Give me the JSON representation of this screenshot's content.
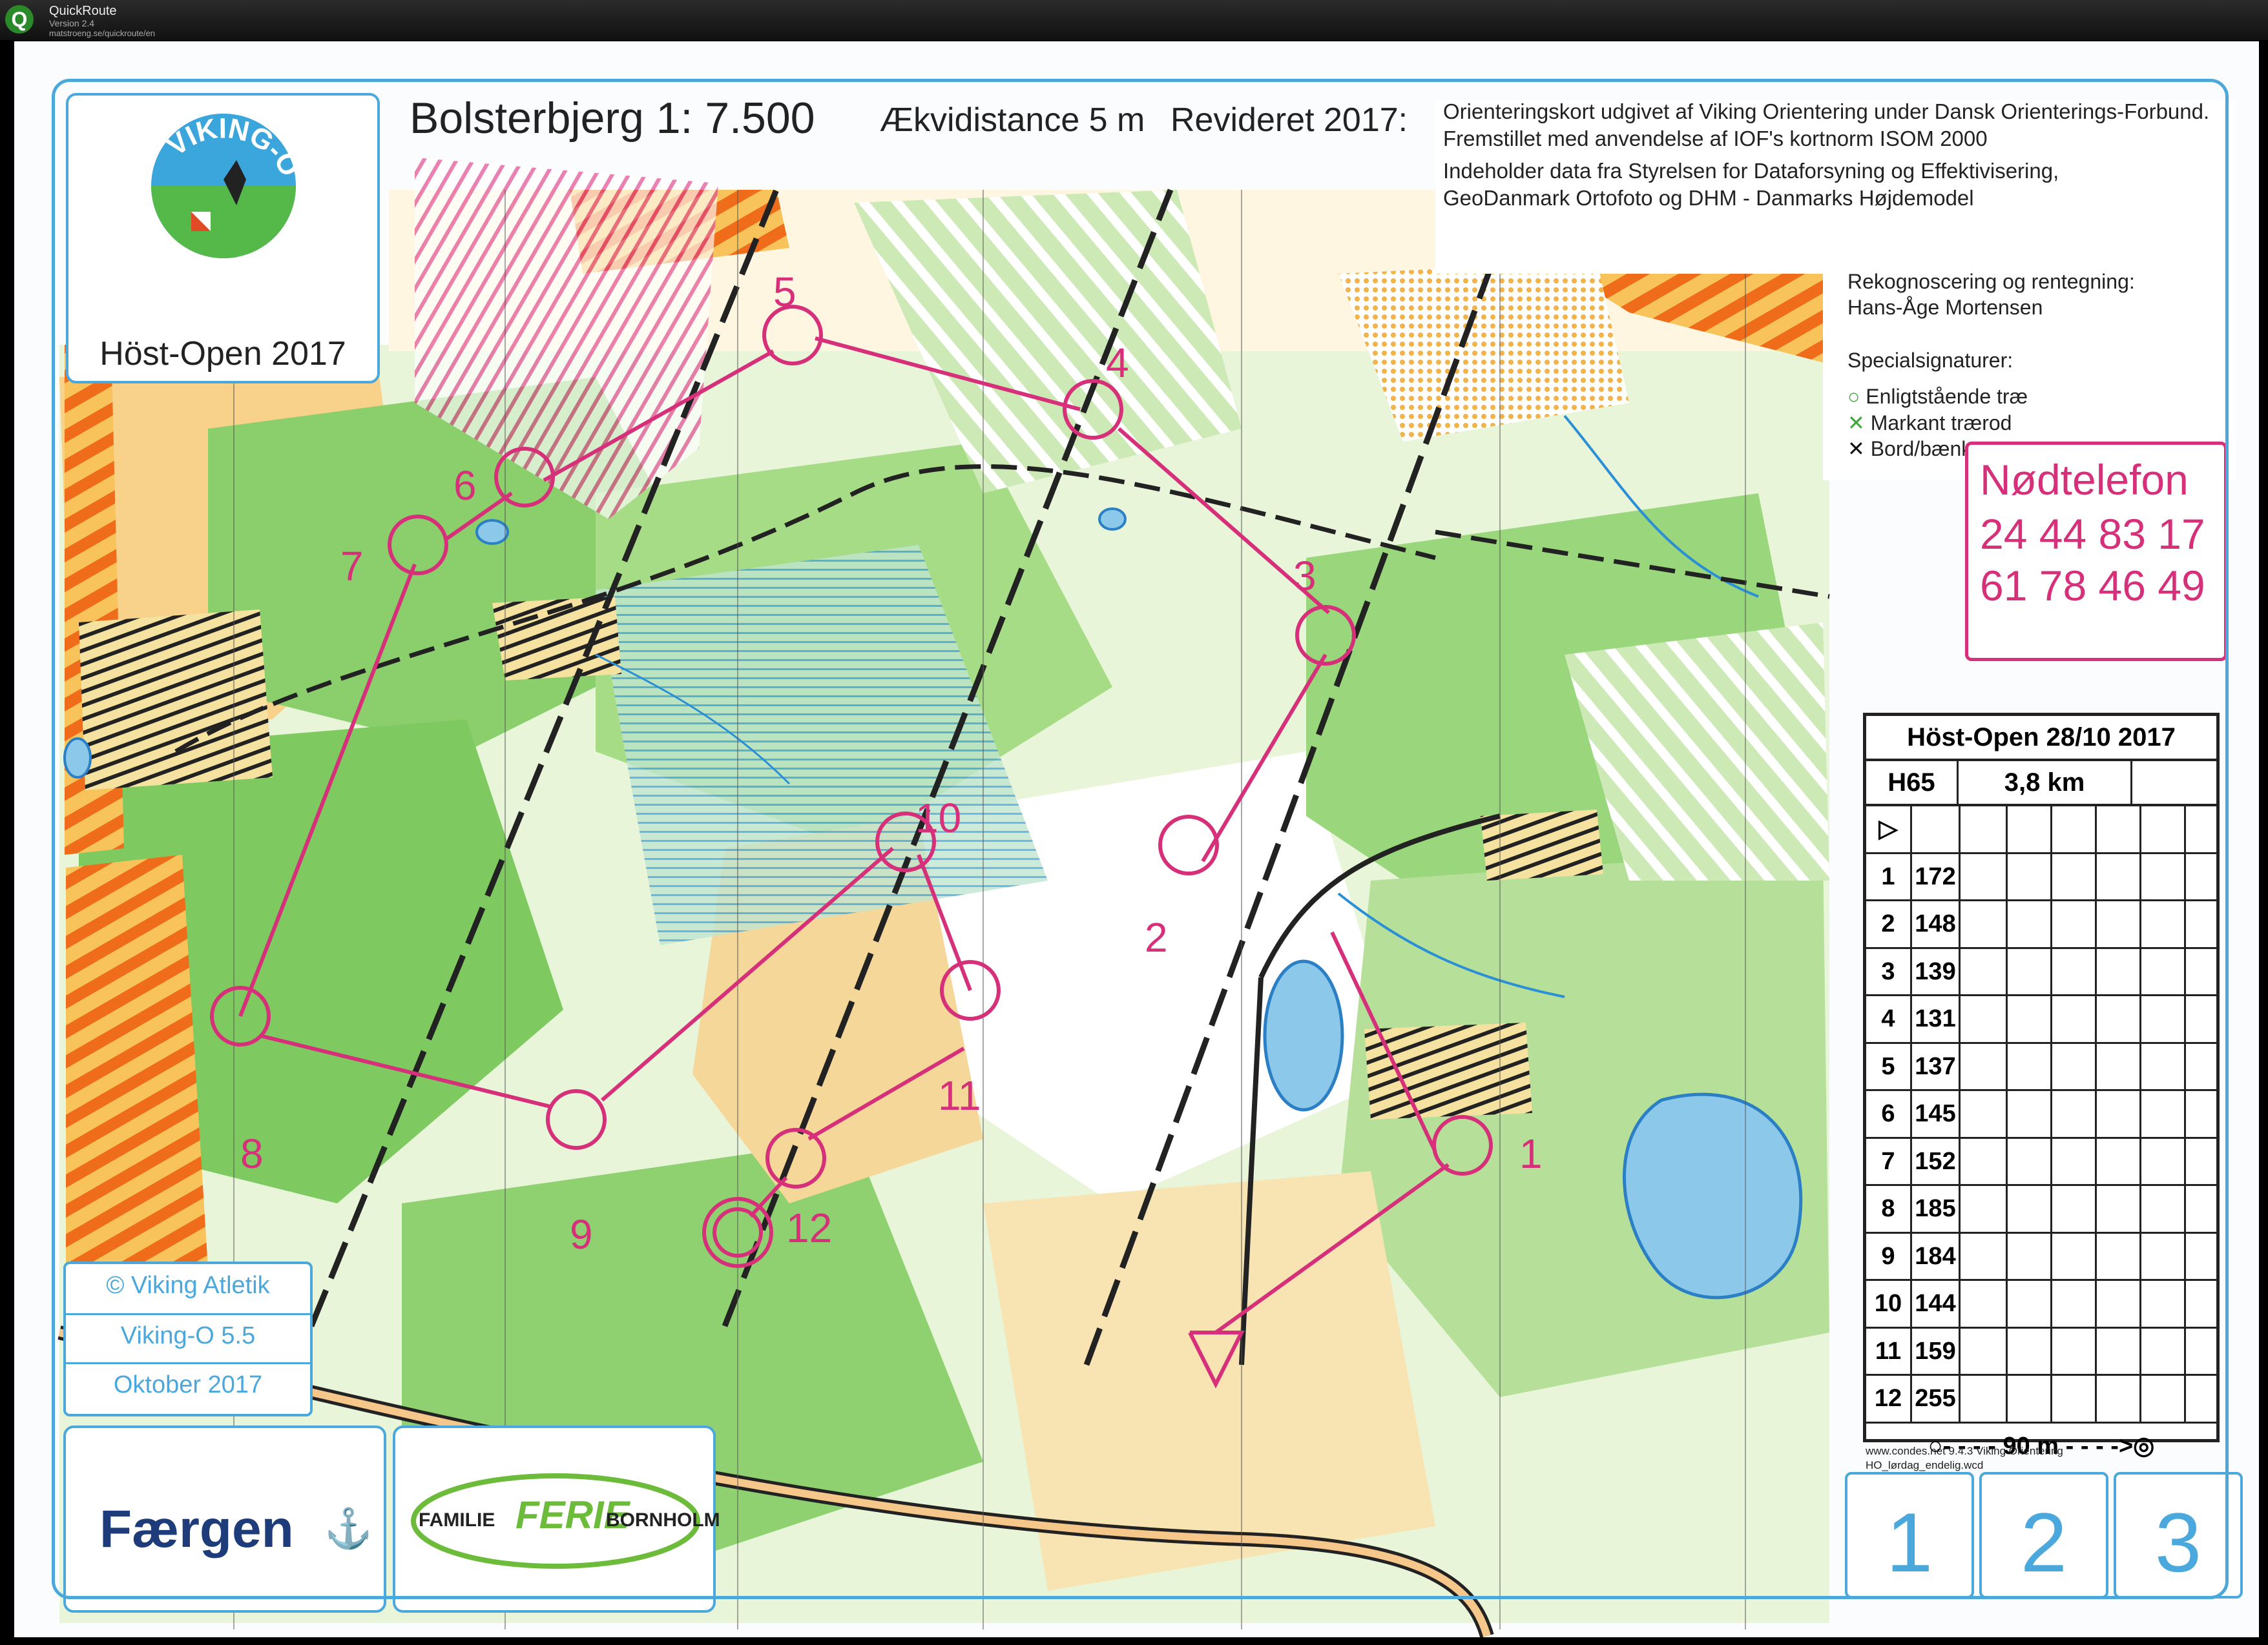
{
  "app": {
    "name": "QuickRoute",
    "version": "Version 2.4",
    "url": "matstroeng.se/quickroute/en"
  },
  "map": {
    "title": "Bolsterbjerg 1: 7.500",
    "contour": "Ækvidistance 5 m",
    "revised": "Revideret 2017:",
    "publisher_lines": [
      "Orienteringskort udgivet af Viking Orientering under Dansk Orienterings-Forbund.",
      "Fremstillet med anvendelse af IOF's kortnorm ISOM 2000",
      "Indeholder data fra Styrelsen for Dataforsyning og Effektivisering,",
      "GeoDanmark Ortofoto og DHM - Danmarks Højdemodel"
    ],
    "survey_label": "Rekognoscering og rentegning:",
    "surveyor": "Hans-Åge Mortensen",
    "special_title": "Specialsignaturer:",
    "special_items": [
      {
        "symbol": "○",
        "text": "Enligtstående træ",
        "color": "#3aa935"
      },
      {
        "symbol": "✕",
        "text": "Markant trærod",
        "color": "#3aa935"
      },
      {
        "symbol": "✕",
        "text": "Bord/bænk sæt",
        "color": "#111111"
      }
    ],
    "emergency_title": "Nødtelefon",
    "emergency_numbers": [
      "24 44 83 17",
      "61 78 46 49"
    ],
    "event_logo_text": "VIKING-O",
    "event_name": "Höst-Open 2017",
    "copyright_lines": [
      "© Viking Atletik",
      "Viking-O 5.5",
      "Oktober 2017"
    ],
    "sponsor1": "Færgen",
    "sponsor2_left": "FAMILIE",
    "sponsor2_mid": "FERIE",
    "sponsor2_right": "BORNHOLM",
    "map_boxes": [
      "1",
      "2",
      "3"
    ],
    "condes_lines": [
      "www.condes.net 9.4.3 Viking Orientering",
      "HO_lørdag_endelig.wcd"
    ]
  },
  "controls": {
    "labels": [
      "1",
      "2",
      "3",
      "4",
      "5",
      "6",
      "7",
      "8",
      "9",
      "10",
      "11",
      "12"
    ]
  },
  "description_sheet": {
    "title": "Höst-Open 28/10 2017",
    "class": "H65",
    "distance": "3,8 km",
    "rows": [
      {
        "n": "1",
        "code": "172"
      },
      {
        "n": "2",
        "code": "148"
      },
      {
        "n": "3",
        "code": "139"
      },
      {
        "n": "4",
        "code": "131"
      },
      {
        "n": "5",
        "code": "137"
      },
      {
        "n": "6",
        "code": "145"
      },
      {
        "n": "7",
        "code": "152"
      },
      {
        "n": "8",
        "code": "185"
      },
      {
        "n": "9",
        "code": "184"
      },
      {
        "n": "10",
        "code": "144"
      },
      {
        "n": "11",
        "code": "159"
      },
      {
        "n": "12",
        "code": "255"
      }
    ],
    "finish_distance": "90 m",
    "colors": {
      "course": "#d6307a",
      "frame": "#4aa8dc"
    }
  }
}
